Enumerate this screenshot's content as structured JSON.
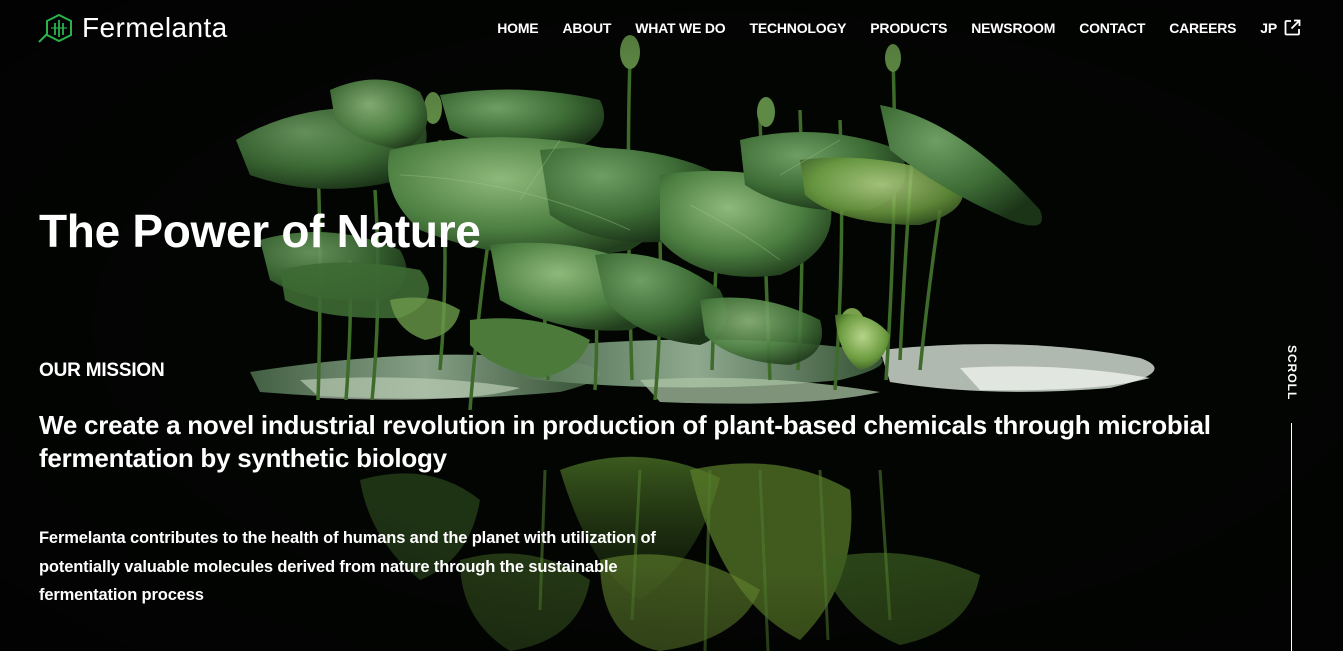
{
  "brand": {
    "name": "Fermelanta",
    "accent": "#2bb24c"
  },
  "nav": {
    "items": [
      {
        "label": "HOME"
      },
      {
        "label": "ABOUT"
      },
      {
        "label": "WHAT WE DO"
      },
      {
        "label": "TECHNOLOGY"
      },
      {
        "label": "PRODUCTS"
      },
      {
        "label": "NEWSROOM"
      },
      {
        "label": "CONTACT"
      },
      {
        "label": "CAREERS"
      }
    ],
    "language": {
      "label": "JP",
      "icon": "external-link-icon"
    }
  },
  "hero": {
    "title": "The Power of Nature",
    "mission_label": "OUR MISSION",
    "mission_statement": "We create a novel industrial revolution in production of plant-based chemicals through microbial fermentation by synthetic biology",
    "mission_body": "Fermelanta contributes to the health of humans and the planet with utilization of potentially valuable molecules derived from nature through the sustainable fermentation process",
    "background": "lotus-leaves-on-dark-water"
  },
  "scroll": {
    "label": "SCROLL"
  }
}
